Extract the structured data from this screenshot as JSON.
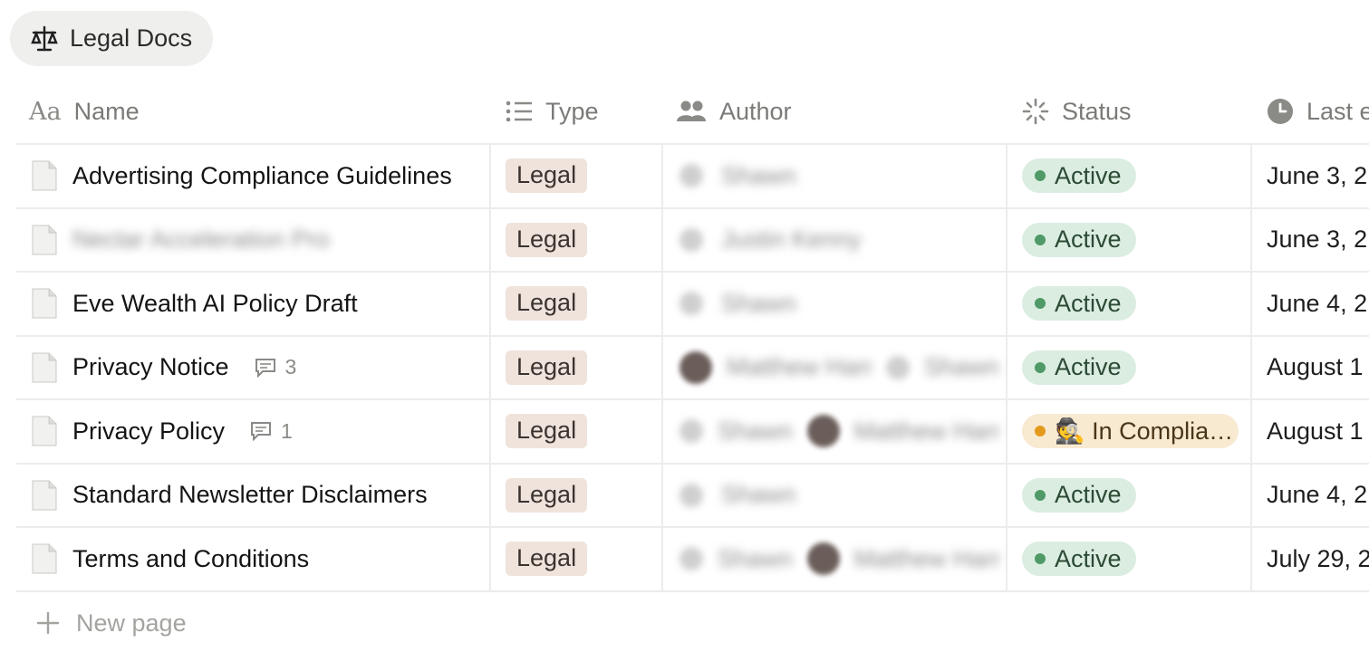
{
  "view": {
    "tab_label": "Legal Docs",
    "icon": "scales-icon"
  },
  "columns": [
    {
      "label": "Name",
      "icon": "text-aa-icon"
    },
    {
      "label": "Type",
      "icon": "list-icon"
    },
    {
      "label": "Author",
      "icon": "people-icon"
    },
    {
      "label": "Status",
      "icon": "status-spinner-icon"
    },
    {
      "label": "Last e",
      "icon": "clock-icon"
    }
  ],
  "rows": [
    {
      "name": "Advertising Compliance Guidelines",
      "type": "Legal",
      "author": "Shawn",
      "status": "Active",
      "date": "June 3, 2"
    },
    {
      "name": "Nectar Acceleration Pro",
      "type": "Legal",
      "author": "Justin Kenny",
      "status": "Active",
      "date": "June 3, 2"
    },
    {
      "name": "Eve Wealth AI Policy Draft",
      "type": "Legal",
      "author": "Shawn",
      "status": "Active",
      "date": "June 4, 2"
    },
    {
      "name": "Privacy Notice",
      "comments": "3",
      "type": "Legal",
      "author": "Matthew Harr",
      "author2": "Shawn",
      "status": "Active",
      "date": "August 1"
    },
    {
      "name": "Privacy Policy",
      "comments": "1",
      "type": "Legal",
      "author": "Shawn",
      "author2": "Matthew Harr",
      "status": "🕵 In Complia…",
      "date": "August 1"
    },
    {
      "name": "Standard Newsletter Disclaimers",
      "type": "Legal",
      "author": "Shawn",
      "status": "Active",
      "date": "June 4, 2"
    },
    {
      "name": "Terms and Conditions",
      "type": "Legal",
      "author": "Shawn",
      "author2": "Matthew Harr",
      "status": "Active",
      "date": "July 29, 2"
    }
  ],
  "new_page_label": "New page",
  "colors": {
    "active_bg": "#dbede1",
    "active_dot": "#4f9a66",
    "compliance_bg": "#f8e9d1",
    "compliance_dot": "#e39a1c",
    "tag_bg": "#efe3dc"
  }
}
